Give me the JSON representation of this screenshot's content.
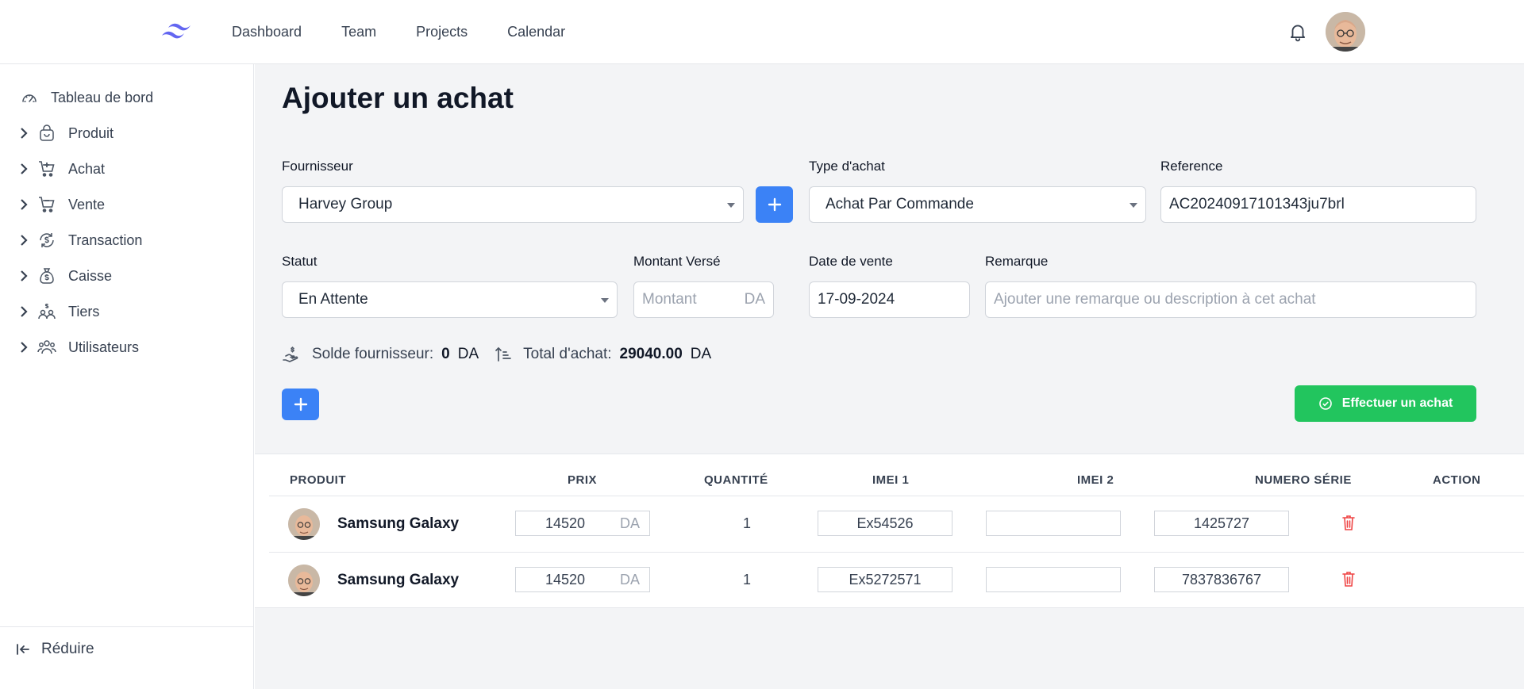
{
  "topnav": {
    "items": [
      "Dashboard",
      "Team",
      "Projects",
      "Calendar"
    ]
  },
  "icons": {
    "logo": "tailwind-logo-icon",
    "bell": "bell-icon",
    "avatar": "user-avatar"
  },
  "sidebar": {
    "items": [
      {
        "label": "Tableau de bord",
        "icon": "gauge-icon",
        "has_chevron": false
      },
      {
        "label": "Produit",
        "icon": "shopping-bag-icon",
        "has_chevron": true
      },
      {
        "label": "Achat",
        "icon": "cart-icon",
        "has_chevron": true
      },
      {
        "label": "Vente",
        "icon": "cart-icon",
        "has_chevron": true
      },
      {
        "label": "Transaction",
        "icon": "dollar-cycle-icon",
        "has_chevron": true
      },
      {
        "label": "Caisse",
        "icon": "money-bag-icon",
        "has_chevron": true
      },
      {
        "label": "Tiers",
        "icon": "users-dollar-icon",
        "has_chevron": true
      },
      {
        "label": "Utilisateurs",
        "icon": "users-icon",
        "has_chevron": true
      }
    ],
    "reduce_label": "Réduire"
  },
  "page": {
    "title": "Ajouter un achat"
  },
  "form": {
    "fournisseur": {
      "label": "Fournisseur",
      "value": "Harvey Group"
    },
    "type_achat": {
      "label": "Type d'achat",
      "value": "Achat Par Commande"
    },
    "reference": {
      "label": "Reference",
      "value": "AC20240917101343ju7brl"
    },
    "statut": {
      "label": "Statut",
      "value": "En Attente"
    },
    "montant": {
      "label": "Montant Versé",
      "placeholder": "Montant",
      "suffix": "DA"
    },
    "date_vente": {
      "label": "Date de vente",
      "value": "17-09-2024"
    },
    "remarque": {
      "label": "Remarque",
      "placeholder": "Ajouter une remarque ou description à cet achat"
    }
  },
  "summary": {
    "solde_label": "Solde fournisseur:",
    "solde_value": "0",
    "solde_currency": "DA",
    "total_label": "Total d'achat:",
    "total_value": "29040.00",
    "total_currency": "DA"
  },
  "actions": {
    "submit_label": "Effectuer un achat",
    "add_symbol": "+"
  },
  "colors": {
    "primary": "#3b82f6",
    "success": "#22c55e",
    "danger": "#ef4444"
  },
  "table": {
    "headers": [
      "PRODUIT",
      "PRIX",
      "QUANTITÉ",
      "IMEI 1",
      "IMEI 2",
      "NUMERO SÉRIE",
      "ACTION"
    ],
    "rows": [
      {
        "product": "Samsung Galaxy",
        "price": "14520",
        "currency": "DA",
        "quantity": "1",
        "imei1": "Ex54526",
        "imei2": "",
        "serial": "1425727"
      },
      {
        "product": "Samsung Galaxy",
        "price": "14520",
        "currency": "DA",
        "quantity": "1",
        "imei1": "Ex5272571",
        "imei2": "",
        "serial": "7837836767"
      }
    ]
  }
}
